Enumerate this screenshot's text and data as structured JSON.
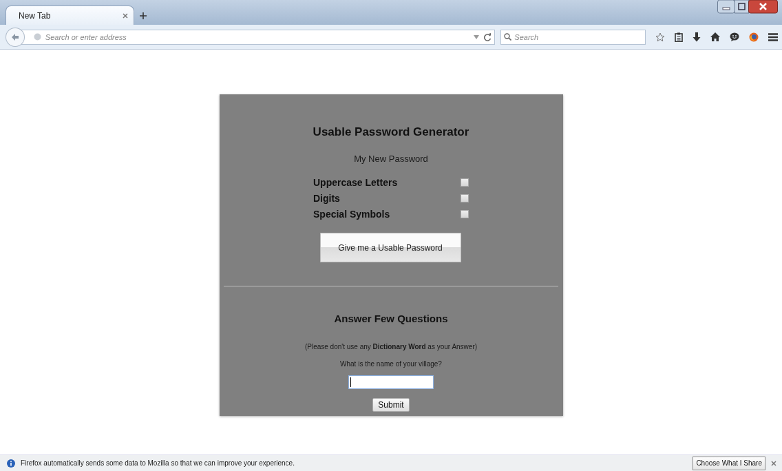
{
  "browser": {
    "tabs": [
      {
        "label": "New Tab",
        "selected": true
      }
    ],
    "address_bar": {
      "placeholder": "Search or enter address"
    },
    "search_bar": {
      "placeholder": "Search"
    }
  },
  "card": {
    "title": "Usable Password Generator",
    "password": "My New Password",
    "options": [
      {
        "label": "Uppercase Letters",
        "checked": false
      },
      {
        "label": "Digits",
        "checked": false
      },
      {
        "label": "Special Symbols",
        "checked": false
      }
    ],
    "generate_button": "Give me a Usable Password",
    "questions_title": "Answer Few Questions",
    "hint": "(Please don't use any **Dictionary Word** as your Answer)",
    "question": "What is the name of your village?",
    "answer": {
      "focused": true
    },
    "submit_button": "Submit"
  },
  "notification": {
    "message": "Firefox automatically sends some data to Mozilla so that we can improve your experience.",
    "button": "Choose What I Share"
  }
}
